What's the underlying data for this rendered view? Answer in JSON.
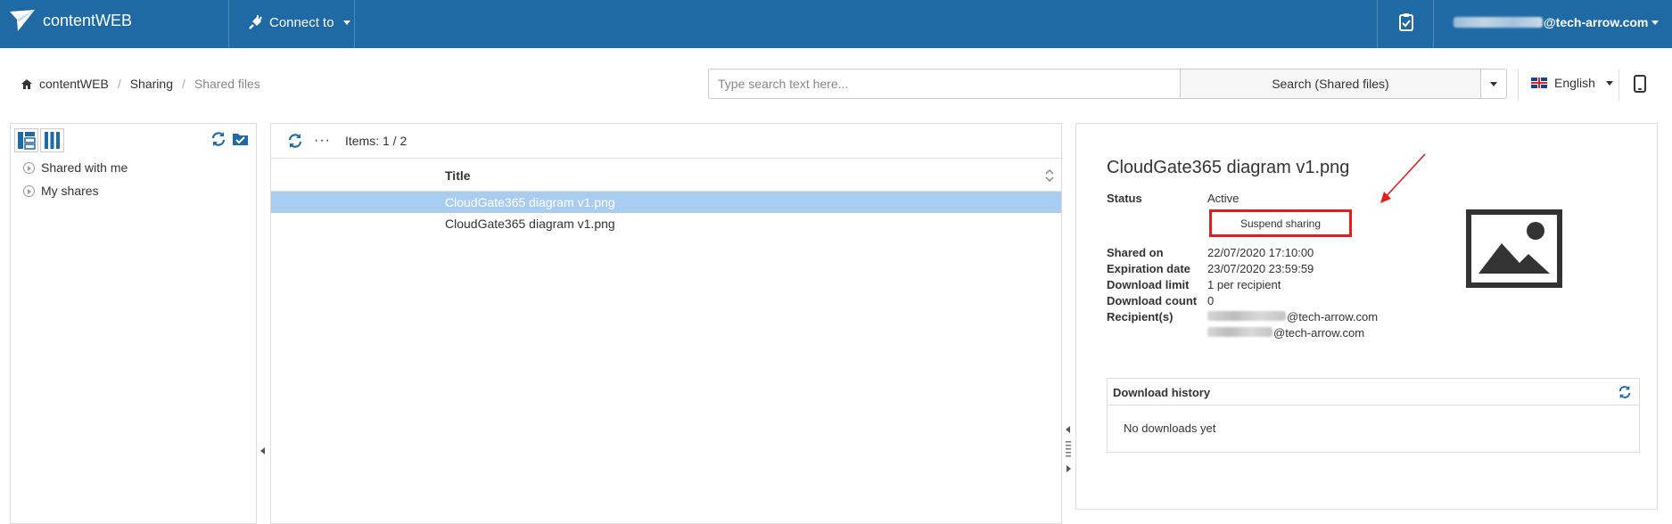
{
  "topbar": {
    "brand": "contentWEB",
    "connect_label": "Connect to",
    "user_suffix": "@tech-arrow.com"
  },
  "breadcrumb": [
    "contentWEB",
    "Sharing",
    "Shared files"
  ],
  "search": {
    "placeholder": "Type search text here...",
    "button_label": "Search (Shared files)"
  },
  "language": "English",
  "tree": {
    "items": [
      "Shared with me",
      "My shares"
    ]
  },
  "list": {
    "items_count": "Items: 1 / 2",
    "column_title": "Title",
    "rows": [
      "CloudGate365 diagram v1.png",
      "CloudGate365 diagram v1.png"
    ]
  },
  "detail": {
    "title": "CloudGate365 diagram v1.png",
    "status_label": "Status",
    "status_value": "Active",
    "status_color": "#3a9a3a",
    "suspend_label": "Suspend sharing",
    "shared_on_label": "Shared on",
    "shared_on_value": "22/07/2020 17:10:00",
    "expiration_label": "Expiration date",
    "expiration_value": "23/07/2020 23:59:59",
    "download_limit_label": "Download limit",
    "download_limit_value": "1 per recipient",
    "download_count_label": "Download count",
    "download_count_value": "0",
    "recipients_label": "Recipient(s)",
    "recipients": [
      "@tech-arrow.com",
      "@tech-arrow.com"
    ]
  },
  "history": {
    "title": "Download history",
    "empty_text": "No downloads yet"
  },
  "colors": {
    "topbar": "#1f6aa5",
    "selected_row": "#a9cdf0",
    "highlight": "#e31c1c",
    "accent": "#1f6aa5"
  }
}
